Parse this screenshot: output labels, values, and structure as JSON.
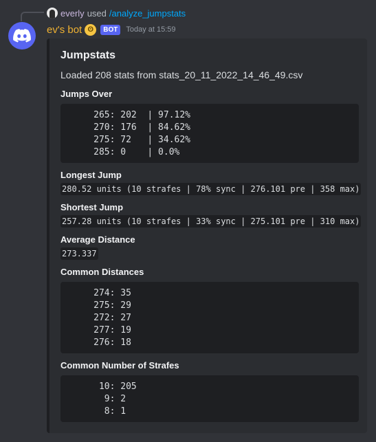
{
  "reply": {
    "username": "everly",
    "verb": "used",
    "command": "/analyze_jumpstats"
  },
  "message": {
    "username": "ev's bot",
    "emoji": "flushed-face-emoji",
    "bot_tag": "BOT",
    "timestamp": "Today at 15:59"
  },
  "embed": {
    "title": "Jumpstats",
    "description": "Loaded 208 stats from stats_20_11_2022_14_46_49.csv",
    "jumps_over": {
      "name": "Jumps Over",
      "rows": [
        "     265: 202  | 97.12%",
        "     270: 176  | 84.62%",
        "     275: 72   | 34.62%",
        "     285: 0    | 0.0%"
      ]
    },
    "longest_jump": {
      "name": "Longest Jump",
      "value": "280.52 units (10 strafes | 78% sync | 276.101 pre | 358 max)"
    },
    "shortest_jump": {
      "name": "Shortest Jump",
      "value": "257.28 units (10 strafes | 33% sync | 275.101 pre | 310 max)"
    },
    "average_distance": {
      "name": "Average Distance",
      "value": "273.337"
    },
    "common_distances": {
      "name": "Common Distances",
      "rows": [
        "     274: 35",
        "     275: 29",
        "     272: 27",
        "     277: 19",
        "     276: 18"
      ]
    },
    "common_strafes": {
      "name": "Common Number of Strafes",
      "rows": [
        "      10: 205",
        "       9: 2",
        "       8: 1"
      ]
    }
  },
  "colors": {
    "background": "#313338",
    "embed_bg": "#2b2d31",
    "code_bg": "#1e1f22",
    "username": "#f0b232",
    "bot_tag": "#5865f2",
    "command_link": "#00a8fc"
  }
}
